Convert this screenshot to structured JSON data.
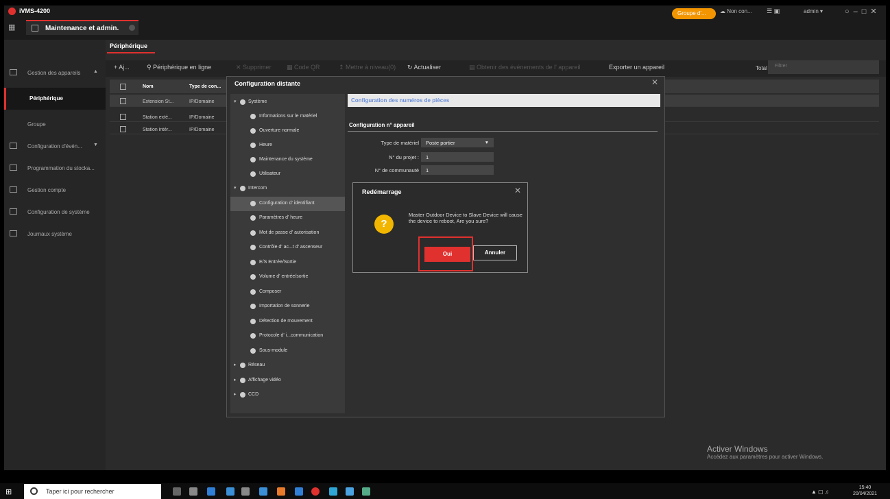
{
  "app": {
    "title": "iVMS-4200",
    "tab": "Maintenance et admin."
  },
  "topright": {
    "group": "Groupe d'...",
    "cloud": "Non con...",
    "user": "admin"
  },
  "nav": {
    "items": [
      {
        "label": "Gestion des appareils"
      },
      {
        "label": "Périphérique"
      },
      {
        "label": "Groupe"
      },
      {
        "label": "Configuration d'évén..."
      },
      {
        "label": "Programmation du stocka..."
      },
      {
        "label": "Gestion compte"
      },
      {
        "label": "Configuration de système"
      },
      {
        "label": "Journaux système"
      }
    ]
  },
  "main": {
    "tab": "Périphérique",
    "toolbar": {
      "add": "+ Aj...",
      "online": "Périphérique en ligne",
      "delete": "Supprimer",
      "qr": "Code QR",
      "upgrade": "Mettre à niveau(0)",
      "refresh": "Actualiser",
      "events": "Obtenir des événements de l' appareil",
      "export": "Exporter un appareil",
      "total": "Total (3)",
      "filter_placeholder": "Filtrer"
    },
    "table": {
      "headers": {
        "name": "Nom",
        "type": "Type de con..."
      },
      "rows": [
        {
          "name": "Extension St...",
          "type": "IP/Domaine"
        },
        {
          "name": "Station exté...",
          "type": "IP/Domaine"
        },
        {
          "name": "Station intér...",
          "type": "IP/Domaine"
        }
      ]
    }
  },
  "remote_config": {
    "title": "Configuration distante",
    "tree": {
      "system": "Système",
      "system_items": [
        "Informations sur le matériel",
        "Ouverture normale",
        "Heure",
        "Maintenance du système",
        "Utilisateur"
      ],
      "intercom": "Intercom",
      "intercom_items": [
        "Configuration d' identifiant",
        "Paramètres d' heure",
        "Mot de passe d' autorisation",
        "Contrôle d' ac...t d' ascenseur",
        "E/S Entrée/Sortie",
        "Volume d' entrée/sortie",
        "Composer",
        "Importation de sonnerie",
        "Détection de mouvement",
        "Protocole d' i...communication",
        "Sous-module"
      ],
      "network": "Réseau",
      "video": "Affichage vidéo",
      "ccd": "CCD"
    },
    "panel_title": "Configuration des numéros de pièces",
    "section": "Configuration n° appareil",
    "fields": [
      {
        "label": "Type de matériel",
        "value": "Poste portier"
      },
      {
        "label": "N° du projet :",
        "value": "1"
      },
      {
        "label": "N° de communauté",
        "value": "1"
      }
    ]
  },
  "dialog": {
    "title": "Redémarrage",
    "message": "Master Outdoor Device to Slave Device will cause the device to reboot, Are you sure?",
    "ok": "Oui",
    "cancel": "Annuler"
  },
  "watermark": {
    "title": "Activer Windows",
    "sub": "Accédez aux paramètres pour activer Windows."
  },
  "taskbar": {
    "search_placeholder": "Taper ici pour rechercher",
    "time": "15:40",
    "date": "20/04/2021"
  },
  "colors": {
    "accent": "#e0312f",
    "warning": "#f2b500",
    "group_badge": "#f29500"
  }
}
